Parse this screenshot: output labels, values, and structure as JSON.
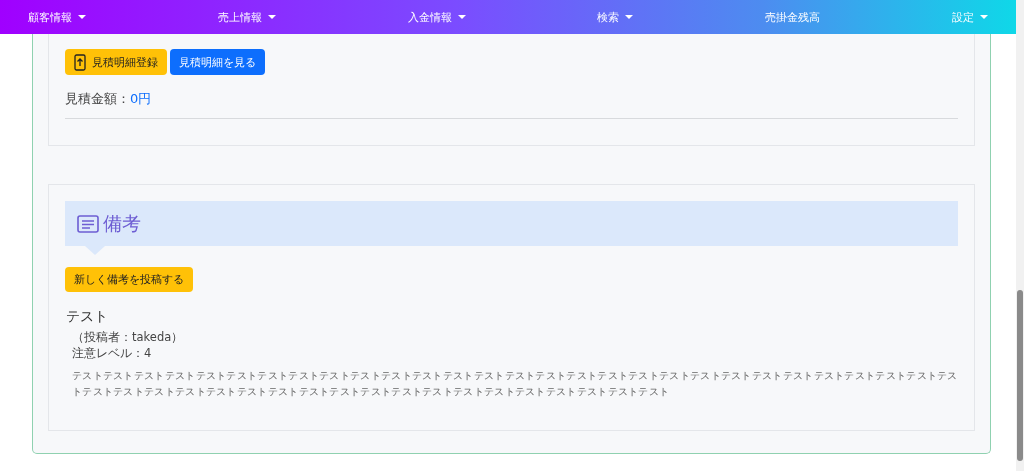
{
  "navbar": {
    "items": [
      {
        "label": "顧客情報",
        "dropdown": true
      },
      {
        "label": "売上情報",
        "dropdown": true
      },
      {
        "label": "入金情報",
        "dropdown": true
      },
      {
        "label": "検索",
        "dropdown": true
      },
      {
        "label": "売掛金残高",
        "dropdown": false
      },
      {
        "label": "設定",
        "dropdown": true
      }
    ]
  },
  "estimate": {
    "buttons": [
      {
        "label": "見積明細登録",
        "kind": "upload"
      },
      {
        "label": "見積明細を見る",
        "kind": "view"
      }
    ],
    "amount_label": "見積金額：",
    "amount_value": "0円"
  },
  "remarks": {
    "title": "備考",
    "new_button": "新しく備考を投稿する",
    "posts": [
      {
        "title": "テスト",
        "author": "（投稿者：takeda）",
        "level": "注意レベル：4",
        "body": "テストテストテストテストテストテストテストテストテストテストテストテストテストテストテストテストテストテストテストテストテストテストテストテストテストテストテストテストテストテストテストテストテストテストテストテストテストテストテストテストテストテストテストテストテストテストテストテスト"
      }
    ]
  }
}
